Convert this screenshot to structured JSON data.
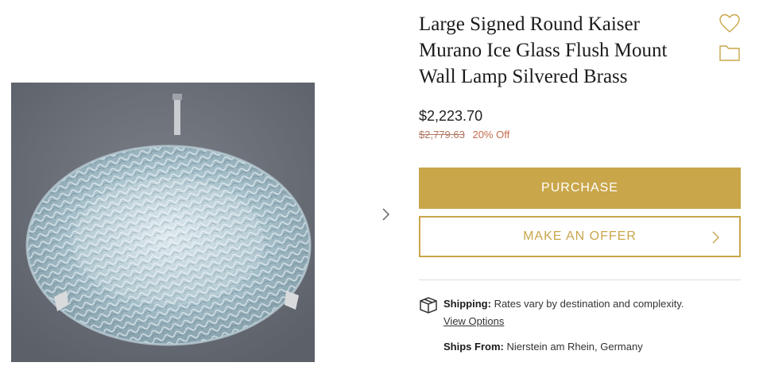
{
  "product": {
    "title": "Large Signed Round Kaiser Murano Ice Glass Flush Mount Wall Lamp Silvered Brass",
    "price": "$2,223.70",
    "original_price": "$2,779.63",
    "discount": "20% Off"
  },
  "buttons": {
    "purchase": "PURCHASE",
    "make_offer": "MAKE AN OFFER"
  },
  "shipping": {
    "label": "Shipping:",
    "text": "Rates vary by destination and complexity.",
    "view_options": "View Options"
  },
  "ships_from": {
    "label": "Ships From:",
    "location": "Nierstein am Rhein, Germany"
  },
  "icons": {
    "favorite": "heart-icon",
    "folder": "folder-icon",
    "next": "chevron-right-icon",
    "shipping": "box-icon"
  },
  "colors": {
    "accent": "#c9a64a",
    "discount": "#c86a4c",
    "photo_background": "#6c7078"
  }
}
